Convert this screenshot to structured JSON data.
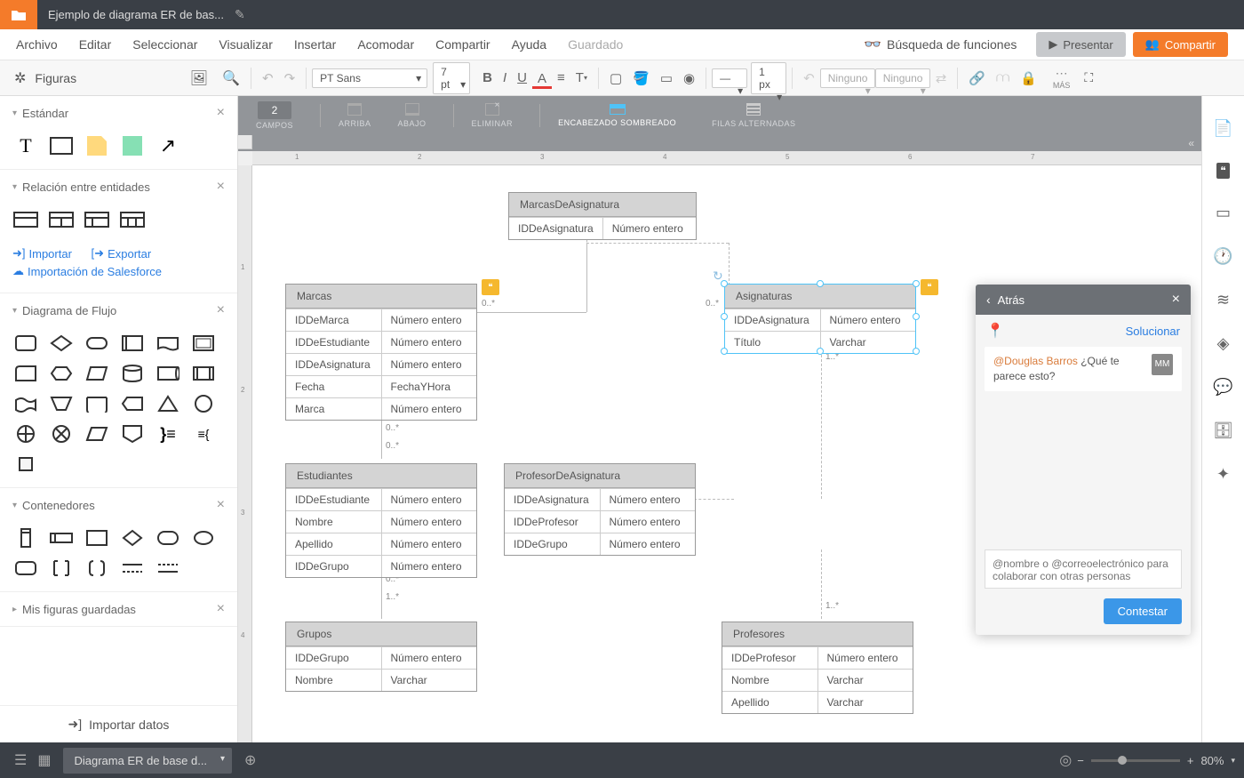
{
  "titlebar": {
    "doc_title": "Ejemplo de diagrama ER de bas..."
  },
  "menubar": {
    "items": [
      "Archivo",
      "Editar",
      "Seleccionar",
      "Visualizar",
      "Insertar",
      "Acomodar",
      "Compartir",
      "Ayuda"
    ],
    "saved": "Guardado",
    "search_func": "Búsqueda de funciones",
    "present": "Presentar",
    "share": "Compartir"
  },
  "toolbar": {
    "figuras": "Figuras",
    "font": "PT Sans",
    "size": "7 pt",
    "line_width": "1 px",
    "none1": "Ninguno",
    "none2": "Ninguno",
    "mas": "MÁS"
  },
  "toolbar2": {
    "campos_value": "2",
    "campos": "CAMPOS",
    "arriba": "ARRIBA",
    "abajo": "ABAJO",
    "eliminar": "ELIMINAR",
    "encabezado": "ENCABEZADO SOMBREADO",
    "filas": "FILAS ALTERNADAS"
  },
  "left_panel": {
    "estandar": "Estándar",
    "relacion": "Relación entre entidades",
    "importar": "Importar",
    "exportar": "Exportar",
    "salesforce": "Importación de Salesforce",
    "flujo": "Diagrama de Flujo",
    "contenedores": "Contenedores",
    "guardadas": "Mis figuras guardadas",
    "importar_datos": "Importar datos"
  },
  "entities": {
    "marcas_asig": {
      "title": "MarcasDeAsignatura",
      "rows": [
        [
          "IDDeAsignatura",
          "Número entero"
        ]
      ]
    },
    "marcas": {
      "title": "Marcas",
      "rows": [
        [
          "IDDeMarca",
          "Número entero"
        ],
        [
          "IDDeEstudiante",
          "Número entero"
        ],
        [
          "IDDeAsignatura",
          "Número entero"
        ],
        [
          "Fecha",
          "FechaYHora"
        ],
        [
          "Marca",
          "Número entero"
        ]
      ]
    },
    "asignaturas": {
      "title": "Asignaturas",
      "rows": [
        [
          "IDDeAsignatura",
          "Número entero"
        ],
        [
          "Título",
          "Varchar"
        ]
      ]
    },
    "estudiantes": {
      "title": "Estudiantes",
      "rows": [
        [
          "IDDeEstudiante",
          "Número entero"
        ],
        [
          "Nombre",
          "Número entero"
        ],
        [
          "Apellido",
          "Número entero"
        ],
        [
          "IDDeGrupo",
          "Número entero"
        ]
      ]
    },
    "profesor_asig": {
      "title": "ProfesorDeAsignatura",
      "rows": [
        [
          "IDDeAsignatura",
          "Número entero"
        ],
        [
          "IDDeProfesor",
          "Número entero"
        ],
        [
          "IDDeGrupo",
          "Número entero"
        ]
      ]
    },
    "grupos": {
      "title": "Grupos",
      "rows": [
        [
          "IDDeGrupo",
          "Número entero"
        ],
        [
          "Nombre",
          "Varchar"
        ]
      ]
    },
    "profesores": {
      "title": "Profesores",
      "rows": [
        [
          "IDDeProfesor",
          "Número entero"
        ],
        [
          "Nombre",
          "Varchar"
        ],
        [
          "Apellido",
          "Varchar"
        ]
      ]
    }
  },
  "cardinalities": {
    "l1": "0..*",
    "l2": "0..*",
    "l3": "0..*",
    "l4": "1..*",
    "l5": "0..*",
    "l6": "1..*",
    "l7": "1..*"
  },
  "comment_panel": {
    "back": "Atrás",
    "solve": "Solucionar",
    "mention": "@Douglas Barros",
    "text": " ¿Qué te parece esto?",
    "avatar": "MM",
    "placeholder": "@nombre o @correoelectrónico para colaborar con otras personas",
    "reply": "Contestar"
  },
  "bottombar": {
    "page_tab": "Diagrama ER de base d...",
    "zoom": "80%"
  }
}
